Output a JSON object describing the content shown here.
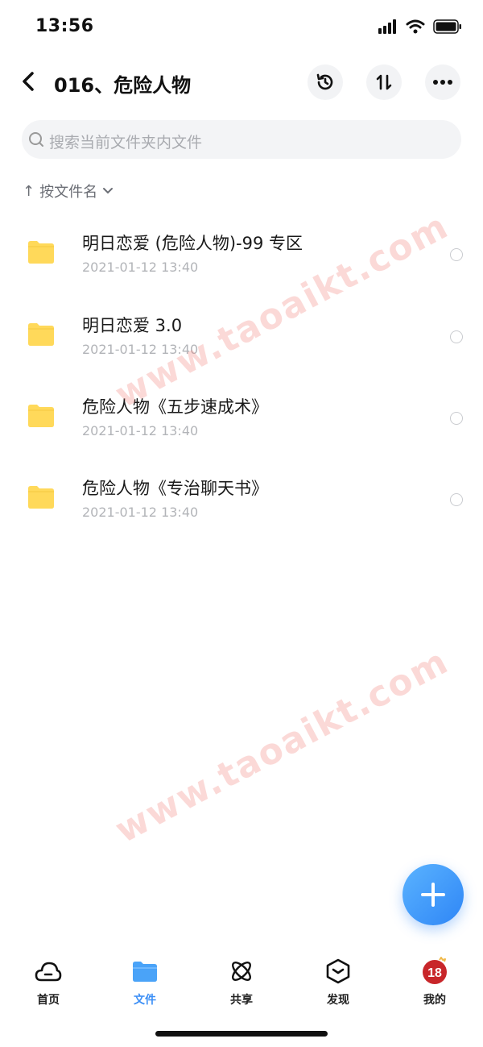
{
  "status": {
    "time": "13:56"
  },
  "header": {
    "title": "016、危险人物",
    "icons": [
      "back-icon",
      "history-icon",
      "sort-icon",
      "more-icon"
    ]
  },
  "search": {
    "placeholder": "搜索当前文件夹内文件"
  },
  "sort": {
    "label": "按文件名",
    "arrow": "↑"
  },
  "files": [
    {
      "name": "明日恋爱 (危险人物)-99 专区",
      "date": "2021-01-12 13:40",
      "icon": "folder-icon"
    },
    {
      "name": "明日恋爱 3.0",
      "date": "2021-01-12 13:40",
      "icon": "folder-icon"
    },
    {
      "name": "危险人物《五步速成术》",
      "date": "2021-01-12 13:40",
      "icon": "folder-icon"
    },
    {
      "name": "危险人物《专治聊天书》",
      "date": "2021-01-12 13:40",
      "icon": "folder-icon"
    }
  ],
  "watermark": "www.taoaikt.com",
  "avatar": {
    "text": "18"
  },
  "tabs": [
    {
      "label": "首页",
      "icon": "cloud-icon",
      "active": false
    },
    {
      "label": "文件",
      "icon": "folder-icon",
      "active": true
    },
    {
      "label": "共享",
      "icon": "atom-icon",
      "active": false
    },
    {
      "label": "发现",
      "icon": "discover-icon",
      "active": false
    },
    {
      "label": "我的",
      "icon": "avatar",
      "active": false
    }
  ],
  "colors": {
    "accent": "#3a8ef6",
    "folder": "#ffd95a",
    "watermark": "#f0786e"
  }
}
